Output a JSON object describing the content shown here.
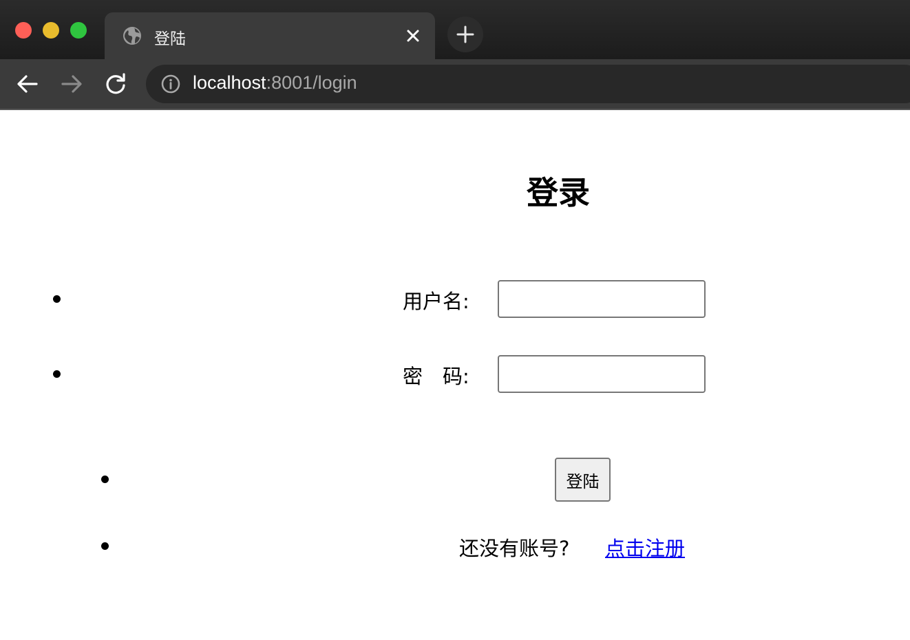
{
  "browser": {
    "tab": {
      "title": "登陆",
      "icon": "globe-icon"
    },
    "new_tab_icon": "plus-icon",
    "toolbar": {
      "back_icon": "arrow-left-icon",
      "forward_icon": "arrow-right-icon",
      "reload_icon": "reload-icon",
      "site_info_icon": "info-icon"
    },
    "address": {
      "host": "localhost",
      "path": ":8001/login"
    },
    "colors": {
      "close": "#fe5f57",
      "minimize": "#e9bc2d",
      "maximize": "#2fc53f"
    }
  },
  "page": {
    "heading": "登录",
    "form": {
      "username_label": "用户名:",
      "username_value": "",
      "password_label": "密　码:",
      "password_value": "",
      "submit_label": "登陆"
    },
    "register": {
      "prompt": "还没有账号?",
      "link_text": "点击注册",
      "link_color": "#0000ee"
    }
  }
}
